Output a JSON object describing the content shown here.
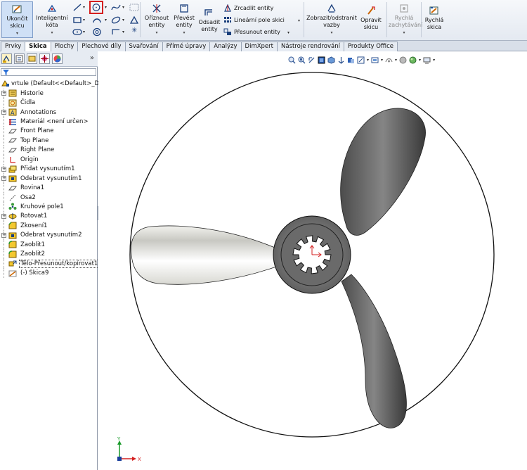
{
  "ribbon": {
    "exit_sketch": "Ukončit skicu",
    "smart_dim": "Inteligentní kóta",
    "trim": "Oříznout entity",
    "convert": "Převést entity",
    "offset": "Odsadit entity",
    "mirror": "Zrcadlit entity",
    "linear_pattern": "Lineární pole skici",
    "move": "Přesunout entity",
    "show_hide": "Zobrazit/odstranit vazby",
    "repair": "Opravit skicu",
    "rapid_snap": "Rychlá zachytávání",
    "rapid_sketch": "Rychlá skica"
  },
  "tabs": [
    "Prvky",
    "Skica",
    "Plochy",
    "Plechové díly",
    "Svařování",
    "Přímé úpravy",
    "Analýzy",
    "DimXpert",
    "Nástroje rendrování",
    "Produkty Office"
  ],
  "tree": {
    "root": "vrtule  (Default<<Default>_Disp",
    "items": [
      {
        "label": "Historie",
        "icon": "history-icon",
        "expand": true
      },
      {
        "label": "Čidla",
        "icon": "sensors-icon",
        "expand": false
      },
      {
        "label": "Annotations",
        "icon": "annotations-icon",
        "expand": true
      },
      {
        "label": "Materiál <není určen>",
        "icon": "material-icon",
        "expand": false
      },
      {
        "label": "Front Plane",
        "icon": "plane-icon",
        "expand": false
      },
      {
        "label": "Top Plane",
        "icon": "plane-icon",
        "expand": false
      },
      {
        "label": "Right Plane",
        "icon": "plane-icon",
        "expand": false
      },
      {
        "label": "Origin",
        "icon": "origin-icon",
        "expand": false
      },
      {
        "label": "Přidat vysunutím1",
        "icon": "extrude-boss-icon",
        "expand": true
      },
      {
        "label": "Odebrat vysunutím1",
        "icon": "extrude-cut-icon",
        "expand": true
      },
      {
        "label": "Rovina1",
        "icon": "plane-icon",
        "expand": false
      },
      {
        "label": "Osa2",
        "icon": "axis-icon",
        "expand": false
      },
      {
        "label": "Kruhové pole1",
        "icon": "circular-pattern-icon",
        "expand": false
      },
      {
        "label": "Rotovat1",
        "icon": "revolve-icon",
        "expand": true
      },
      {
        "label": "Zkosení1",
        "icon": "chamfer-icon",
        "expand": false
      },
      {
        "label": "Odebrat vysunutím2",
        "icon": "extrude-cut-icon",
        "expand": true
      },
      {
        "label": "Zaoblit1",
        "icon": "fillet-icon",
        "expand": false
      },
      {
        "label": "Zaoblit2",
        "icon": "fillet-icon",
        "expand": false
      },
      {
        "label": "Tělo-Přesunout/kopírovat1",
        "icon": "move-body-icon",
        "expand": false
      },
      {
        "label": "(-) Skica9",
        "icon": "sketch-icon",
        "expand": false
      }
    ]
  },
  "view": {
    "triad_y": "Y",
    "triad_x": "X"
  },
  "colors": {
    "accent": "#1a4f9c",
    "blade": "#6a6a6a",
    "active_tool": "#d42020"
  }
}
